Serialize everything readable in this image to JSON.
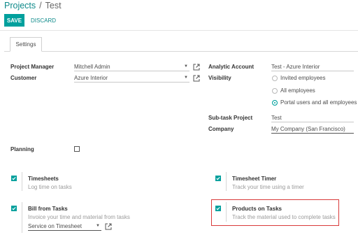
{
  "breadcrumb": {
    "parent": "Projects",
    "separator": "/",
    "current": "Test"
  },
  "toolbar": {
    "save_label": "SAVE",
    "discard_label": "DISCARD"
  },
  "tabs": [
    {
      "label": "Settings",
      "active": true
    }
  ],
  "fields": {
    "project_manager": {
      "label": "Project Manager",
      "value": "Mitchell Admin"
    },
    "customer": {
      "label": "Customer",
      "value": "Azure Interior"
    },
    "analytic_account": {
      "label": "Analytic Account",
      "value": "Test - Azure Interior"
    },
    "visibility": {
      "label": "Visibility",
      "options": [
        {
          "label": "Invited employees",
          "selected": false
        },
        {
          "label": "All employees",
          "selected": false
        },
        {
          "label": "Portal users and all employees",
          "selected": true
        }
      ]
    },
    "subtask_project": {
      "label": "Sub-task Project",
      "value": "Test"
    },
    "company": {
      "label": "Company",
      "value": "My Company (San Francisco)"
    },
    "planning": {
      "label": "Planning",
      "checked": false
    }
  },
  "options": {
    "timesheets": {
      "title": "Timesheets",
      "description": "Log time on tasks",
      "checked": true
    },
    "timesheet_timer": {
      "title": "Timesheet Timer",
      "description": "Track your time using a timer",
      "checked": true
    },
    "bill_from_tasks": {
      "title": "Bill from Tasks",
      "description": "Invoice your time and material from tasks",
      "checked": true,
      "select_value": "Service on Timesheet"
    },
    "products_on_tasks": {
      "title": "Products on Tasks",
      "description": "Track the material used to complete tasks",
      "checked": true
    }
  },
  "colors": {
    "accent": "#00a09d",
    "link": "#0e8a8a",
    "highlight": "#d93a3a"
  },
  "icons": {
    "external_link": "external-link-icon",
    "dropdown": "caret-down-icon",
    "check": "check-icon"
  }
}
